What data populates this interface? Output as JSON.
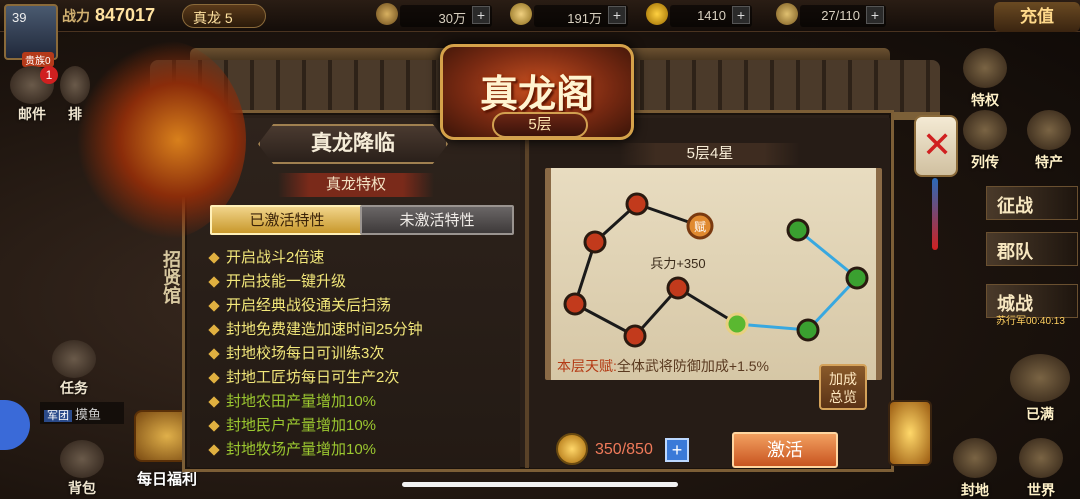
{
  "topbar": {
    "level": "39",
    "vip": "贵族0",
    "power_label": "战力",
    "power_value": "847017",
    "rank_label": "真龙 5",
    "resources": [
      {
        "icon": "wheat-icon",
        "value": "30万"
      },
      {
        "icon": "coins-icon",
        "value": "191万"
      },
      {
        "icon": "gold-ingot-icon",
        "value": "1410"
      },
      {
        "icon": "stamina-icon",
        "value": "27/110"
      }
    ],
    "recharge_label": "充值"
  },
  "left_menu": {
    "mail_label": "邮件",
    "mail_badge": "1",
    "rank_label": "排",
    "task_label": "任务",
    "bag_label": "背包",
    "recruit_label": "招贤馆",
    "chat_tag": "军团",
    "chat_text": "摸鱼",
    "daily_label": "每日福利"
  },
  "right_menu": {
    "privilege_label": "特权",
    "biography_label": "列传",
    "specialty_label": "特产",
    "campaign_label": "征战",
    "county_label": "郡队",
    "city_battle_label": "城战",
    "city_battle_timer": "苏行军00:40:13",
    "full_label": "已满",
    "fief_label": "封地",
    "world_label": "世界"
  },
  "panel": {
    "title": "真龙阁",
    "floor_tag": "5层",
    "subtitle": "真龙降临",
    "privilege_bar": "真龙特权",
    "tab_active": "已激活特性",
    "tab_inactive": "未激活特性",
    "features": [
      {
        "text": "开启战斗2倍速",
        "active": true
      },
      {
        "text": "开启技能一键升级",
        "active": true
      },
      {
        "text": "开启经典战役通关后扫荡",
        "active": true
      },
      {
        "text": "封地免费建造加速时间25分钟",
        "active": true
      },
      {
        "text": "封地校场每日可训练3次",
        "active": true
      },
      {
        "text": "封地工匠坊每日可生产2次",
        "active": true
      },
      {
        "text": "封地农田产量增加10%",
        "active": false
      },
      {
        "text": "封地民户产量增加10%",
        "active": false
      },
      {
        "text": "封地牧场产量增加10%",
        "active": false
      }
    ],
    "star_bar": "5层4星",
    "node_bonus_label": "兵力+350",
    "node_talent_badge": "赋",
    "talent_key": "本层天赋:",
    "talent_value": "全体武将防御加成+1.5%",
    "bonus_overview_line1": "加成",
    "bonus_overview_line2": "总览",
    "cost": "350/850",
    "plus_label": "+",
    "activate_label": "激活",
    "close_label": "✕",
    "colors": {
      "red_node": "#c23a1c",
      "green_node": "#3aa030",
      "link_active": "#38a8e0",
      "link_inactive": "#1a1a1a"
    }
  }
}
